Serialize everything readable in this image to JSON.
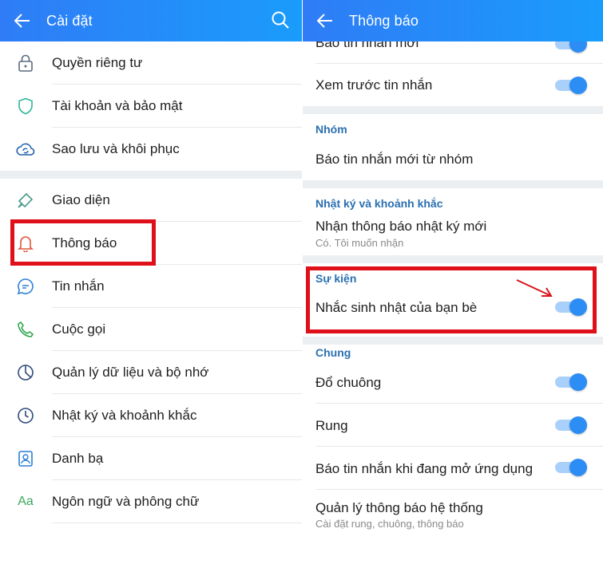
{
  "left": {
    "title": "Cài đặt",
    "items": [
      {
        "label": "Quyền riêng tư"
      },
      {
        "label": "Tài khoản và bảo mật"
      },
      {
        "label": "Sao lưu và khôi phục"
      },
      {
        "label": "Giao diện"
      },
      {
        "label": "Thông báo"
      },
      {
        "label": "Tin nhắn"
      },
      {
        "label": "Cuộc gọi"
      },
      {
        "label": "Quản lý dữ liệu và bộ nhớ"
      },
      {
        "label": "Nhật ký và khoảnh khắc"
      },
      {
        "label": "Danh bạ"
      },
      {
        "label": "Ngôn ngữ và phông chữ",
        "icon_text": "Aa"
      }
    ]
  },
  "right": {
    "title": "Thông báo",
    "top_partial": "Báo tin nhắn mới",
    "preview": "Xem trước tin nhắn",
    "group_section": "Nhóm",
    "group_item": "Báo tin nhắn mới từ nhóm",
    "diary_section": "Nhật ký và khoảnh khắc",
    "diary_item": "Nhận thông báo nhật ký mới",
    "diary_sub": "Có. Tôi muốn nhận",
    "event_section": "Sự kiện",
    "event_item": "Nhắc sinh nhật của bạn bè",
    "general_section": "Chung",
    "ring": "Đổ chuông",
    "vibrate": "Rung",
    "inapp": "Báo tin nhắn khi đang mở ứng dụng",
    "system": "Quản lý thông báo hệ thống",
    "system_sub": "Cài đặt rung, chuông, thông báo"
  },
  "colors": {
    "appbar_start": "#2f7cf6",
    "appbar_end": "#1a9cfb",
    "section_text": "#2a6fb0",
    "toggle_on": "#2c8df4",
    "highlight": "#e0101a"
  }
}
